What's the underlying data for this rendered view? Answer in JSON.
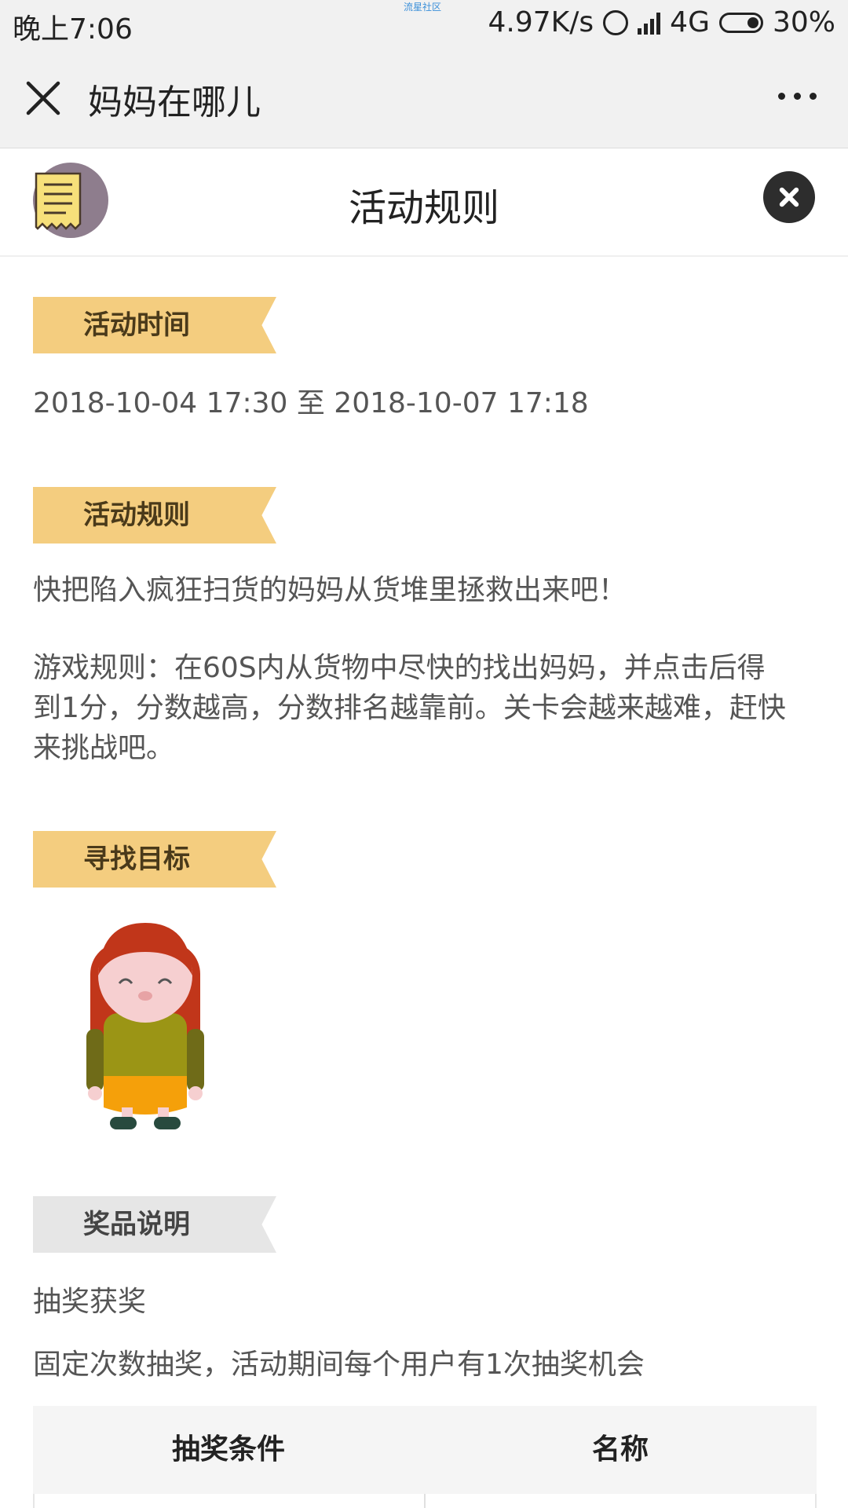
{
  "status_bar": {
    "time": "晚上7:06",
    "center_text": "流星社区",
    "speed": "4.97K/s",
    "network": "4G",
    "battery": "30%"
  },
  "title_bar": {
    "title": "妈妈在哪儿"
  },
  "modal": {
    "title": "活动规则"
  },
  "sections": {
    "time": {
      "label": "活动时间",
      "value": "2018-10-04 17:30 至 2018-10-07 17:18"
    },
    "rules": {
      "label": "活动规则",
      "intro": "快把陷入疯狂扫货的妈妈从货堆里拯救出来吧！",
      "line1": "游戏规则：在60S内从货物中尽快的找出妈妈，并点击后得",
      "line2": "到1分，分数越高，分数排名越靠前。关卡会越来越难，赶快",
      "line3": "来挑战吧。"
    },
    "target": {
      "label": "寻找目标"
    },
    "prize": {
      "label": "奖品说明",
      "type": "抽奖获奖",
      "desc": "固定次数抽奖，活动期间每个用户有1次抽奖机会",
      "table_headers": [
        "抽奖条件",
        "名称"
      ]
    }
  },
  "colors": {
    "ribbon_active": "#f4cd7f",
    "ribbon_inactive": "#e6e6e6",
    "bar_bg": "#f1f1f1"
  }
}
